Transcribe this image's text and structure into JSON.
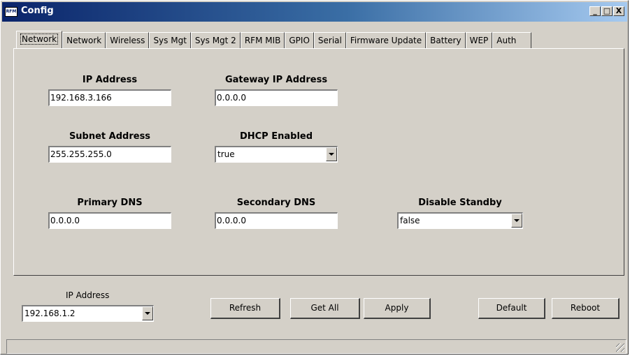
{
  "window": {
    "title": "Config",
    "icon_text": "RFM"
  },
  "window_controls": {
    "minimize": "_",
    "maximize": "□",
    "close": "X"
  },
  "tabs": [
    {
      "label": "Network"
    },
    {
      "label": "Network"
    },
    {
      "label": "Wireless"
    },
    {
      "label": "Sys Mgt"
    },
    {
      "label": "Sys Mgt 2"
    },
    {
      "label": "RFM MIB"
    },
    {
      "label": "GPIO"
    },
    {
      "label": "Serial"
    },
    {
      "label": "Firmware Update"
    },
    {
      "label": "Battery"
    },
    {
      "label": "WEP"
    },
    {
      "label": "Auth"
    }
  ],
  "fields": {
    "ip_address": {
      "label": "IP Address",
      "value": "192.168.3.166"
    },
    "gateway_ip": {
      "label": "Gateway IP Address",
      "value": "0.0.0.0"
    },
    "subnet": {
      "label": "Subnet Address",
      "value": "255.255.255.0"
    },
    "dhcp": {
      "label": "DHCP Enabled",
      "value": "true"
    },
    "primary_dns": {
      "label": "Primary DNS",
      "value": "0.0.0.0"
    },
    "secondary_dns": {
      "label": "Secondary DNS",
      "value": "0.0.0.0"
    },
    "disable_standby": {
      "label": "Disable Standby",
      "value": "false"
    }
  },
  "bottom": {
    "ip_label": "IP Address",
    "ip_value": "192.168.1.2",
    "refresh": "Refresh",
    "get_all": "Get All",
    "apply": "Apply",
    "default": "Default",
    "reboot": "Reboot"
  }
}
